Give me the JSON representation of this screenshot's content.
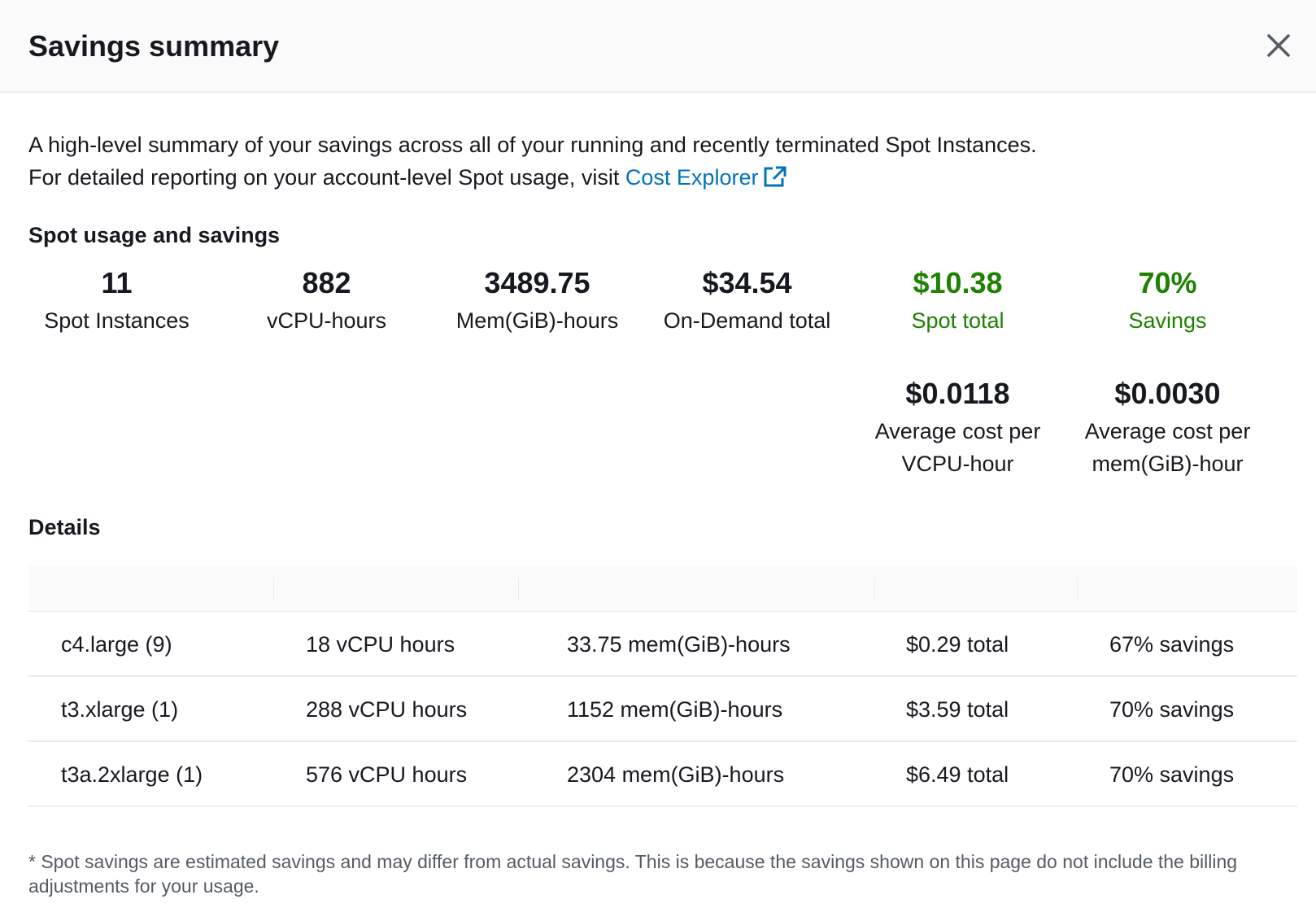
{
  "header": {
    "title": "Savings summary"
  },
  "intro": {
    "line1": "A high-level summary of your savings across all of your running and recently terminated Spot Instances.",
    "line2_prefix": "For detailed reporting on your account-level Spot usage, visit ",
    "link_label": "Cost Explorer"
  },
  "usage": {
    "title": "Spot usage and savings",
    "metrics": [
      {
        "value": "11",
        "label": "Spot Instances"
      },
      {
        "value": "882",
        "label": "vCPU-hours"
      },
      {
        "value": "3489.75",
        "label": "Mem(GiB)-hours"
      },
      {
        "value": "$34.54",
        "label": "On-Demand total"
      },
      {
        "value": "$10.38",
        "label": "Spot total"
      },
      {
        "value": "70%",
        "label": "Savings"
      }
    ],
    "averages": [
      {
        "value": "$0.0118",
        "label_line1": "Average cost per",
        "label_line2": "VCPU-hour"
      },
      {
        "value": "$0.0030",
        "label_line1": "Average cost per",
        "label_line2": "mem(GiB)-hour"
      }
    ]
  },
  "details": {
    "title": "Details",
    "rows": [
      {
        "type": "c4.large (9)",
        "vcpu": "18 vCPU hours",
        "mem": "33.75 mem(GiB)-hours",
        "total": "$0.29 total",
        "savings": "67% savings"
      },
      {
        "type": "t3.xlarge (1)",
        "vcpu": "288 vCPU hours",
        "mem": "1152 mem(GiB)-hours",
        "total": "$3.59 total",
        "savings": "70% savings"
      },
      {
        "type": "t3a.2xlarge (1)",
        "vcpu": "576 vCPU hours",
        "mem": "2304 mem(GiB)-hours",
        "total": "$6.49 total",
        "savings": "70% savings"
      }
    ]
  },
  "footnote": "* Spot savings are estimated savings and may differ from actual savings. This is because the savings shown on this page do not include the billing adjustments for your usage.",
  "colors": {
    "link": "#0073bb",
    "savings_green": "#1d8102",
    "text": "#16191f",
    "muted": "#545b64"
  }
}
